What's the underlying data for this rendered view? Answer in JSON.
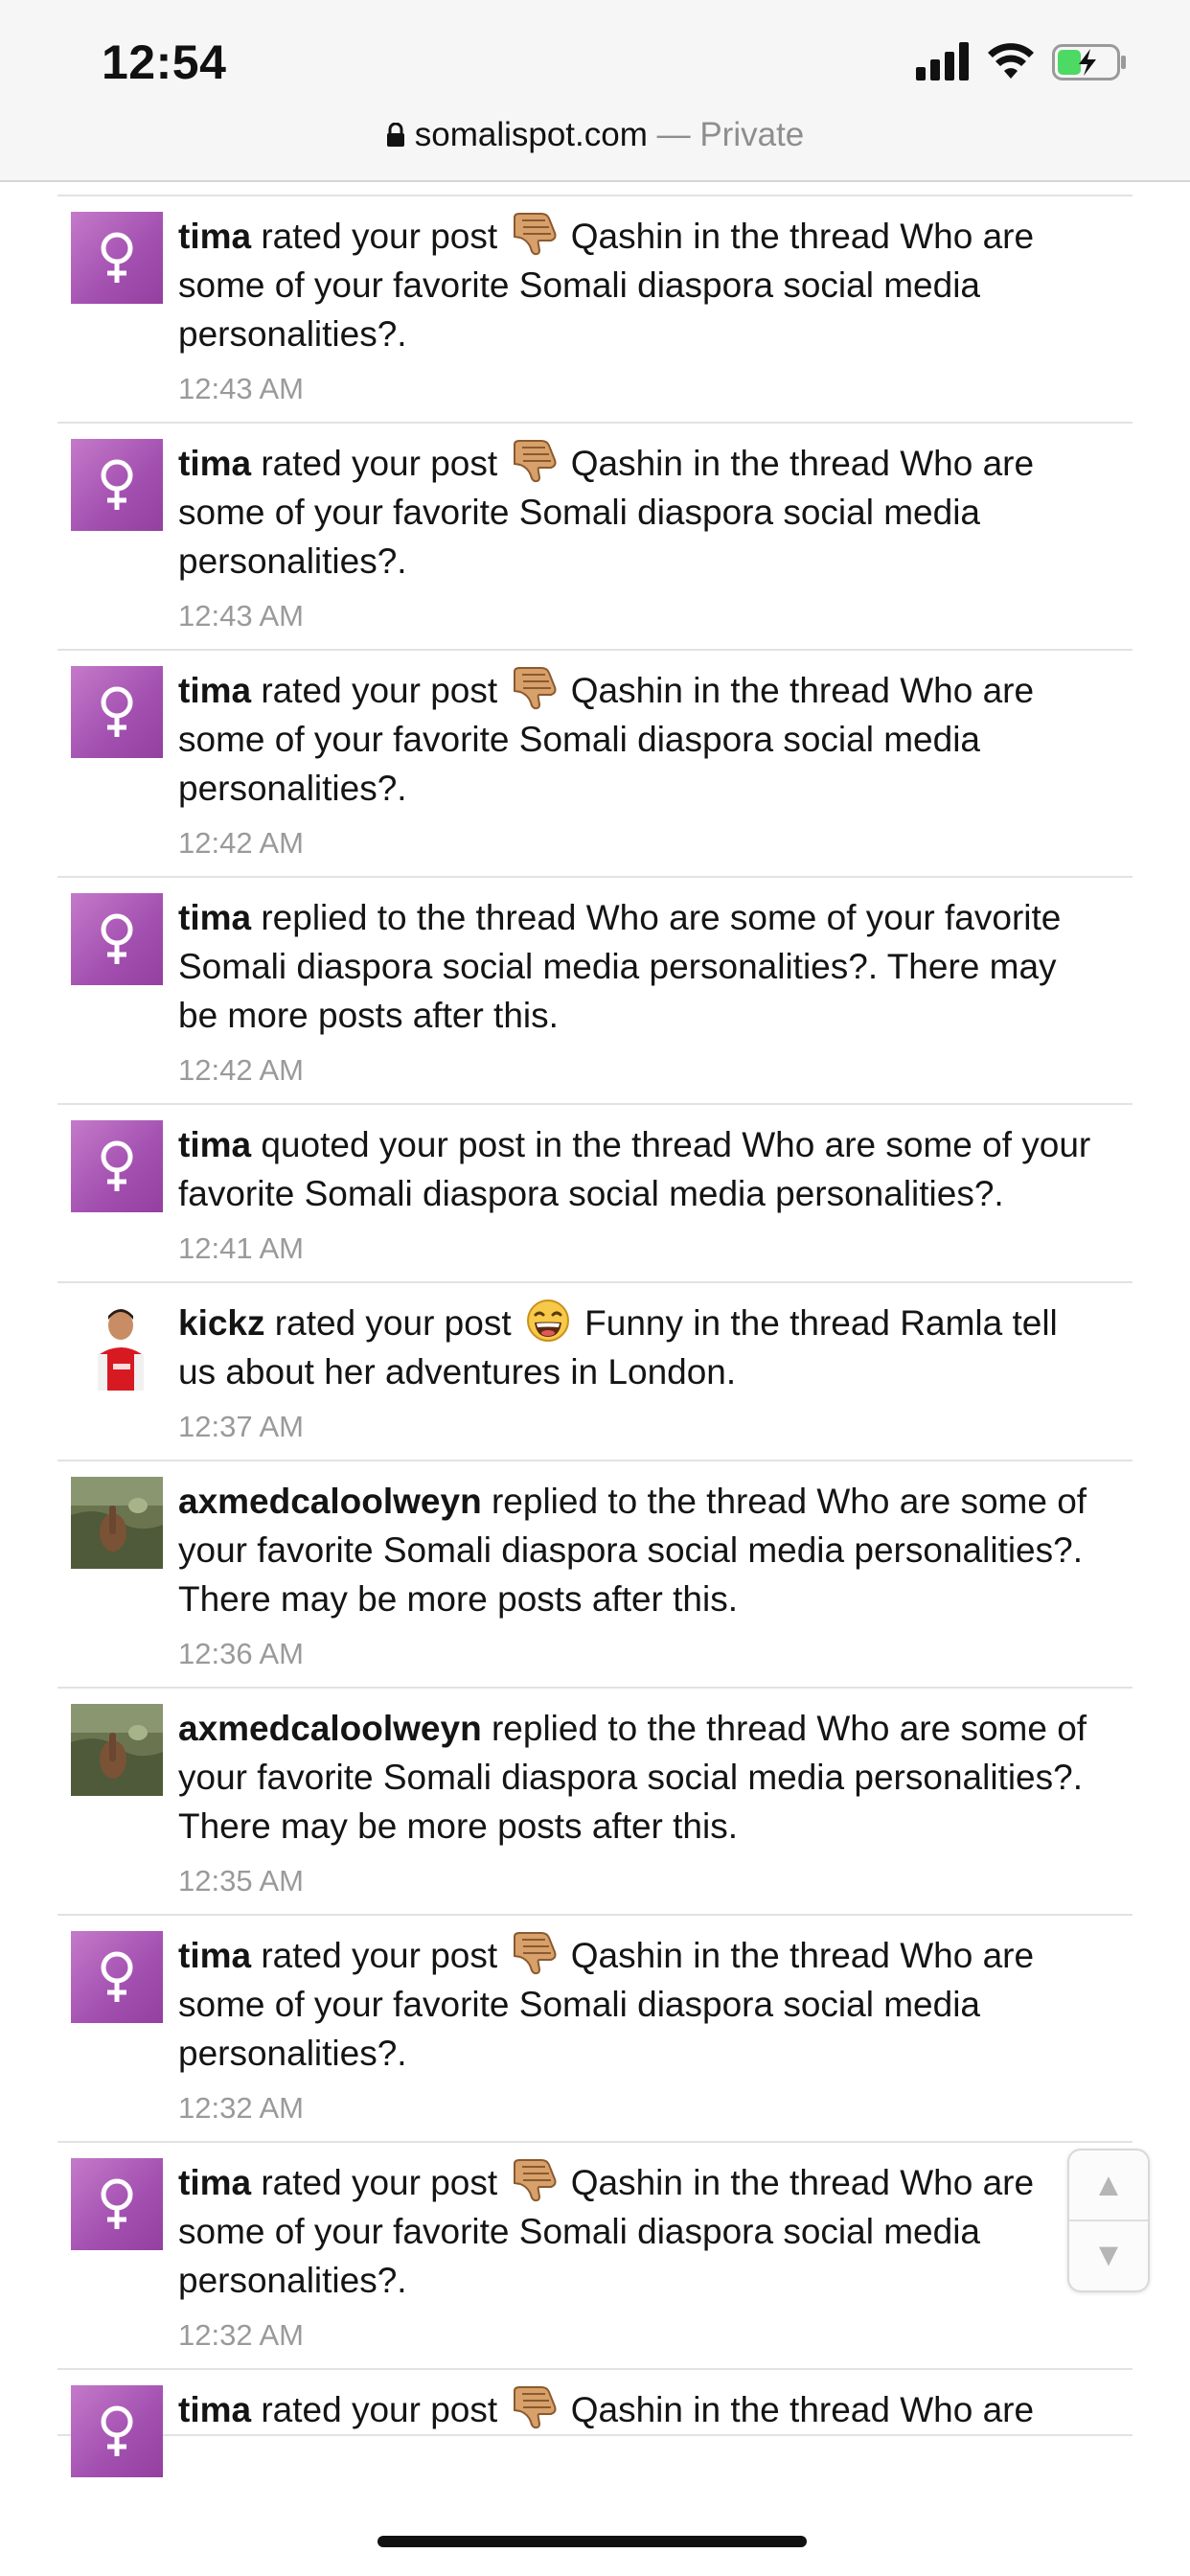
{
  "status_bar": {
    "time": "12:54"
  },
  "url_bar": {
    "domain": "somalispot.com",
    "separator": " — ",
    "mode": "Private"
  },
  "icons": {
    "rating_qashin": "thumbs-down-hand-icon",
    "rating_funny": "laughing-face-icon",
    "avatar_default": "female-symbol-icon",
    "lock": "lock-icon",
    "scroll_up": "triangle-up-icon",
    "scroll_down": "triangle-down-icon"
  },
  "colors": {
    "avatar_purple": "#a24fb0",
    "timestamp_gray": "#9a9a9a",
    "divider": "#e2e2e2"
  },
  "alerts": [
    {
      "user": "tima",
      "avatar": "female",
      "pre": " rated your post ",
      "rating": "thumbs-down-hand-icon",
      "post": " Qashin in the thread Who are some of your favorite Somali diaspora social media personalities?.",
      "time": "12:43 AM"
    },
    {
      "user": "tima",
      "avatar": "female",
      "pre": " rated your post ",
      "rating": "thumbs-down-hand-icon",
      "post": " Qashin in the thread Who are some of your favorite Somali diaspora social media personalities?.",
      "time": "12:43 AM"
    },
    {
      "user": "tima",
      "avatar": "female",
      "pre": " rated your post ",
      "rating": "thumbs-down-hand-icon",
      "post": " Qashin in the thread Who are some of your favorite Somali diaspora social media personalities?.",
      "time": "12:42 AM"
    },
    {
      "user": "tima",
      "avatar": "female",
      "pre": " replied to the thread Who are some of your favorite Somali diaspora social media personalities?. There may be more posts after this.",
      "rating": null,
      "post": "",
      "time": "12:42 AM"
    },
    {
      "user": "tima",
      "avatar": "female",
      "pre": " quoted your post in the thread Who are some of your favorite Somali diaspora social media personalities?.",
      "rating": null,
      "post": "",
      "time": "12:41 AM"
    },
    {
      "user": "kickz",
      "avatar": "kickz",
      "pre": " rated your post ",
      "rating": "laughing-face-icon",
      "post": " Funny in the thread Ramla tell us about her adventures in London.",
      "time": "12:37 AM"
    },
    {
      "user": "axmedcaloolweyn",
      "avatar": "axmed",
      "pre": " replied to the thread Who are some of your favorite Somali diaspora social media personalities?. There may be more posts after this.",
      "rating": null,
      "post": "",
      "time": "12:36 AM"
    },
    {
      "user": "axmedcaloolweyn",
      "avatar": "axmed",
      "pre": " replied to the thread Who are some of your favorite Somali diaspora social media personalities?. There may be more posts after this.",
      "rating": null,
      "post": "",
      "time": "12:35 AM"
    },
    {
      "user": "tima",
      "avatar": "female",
      "pre": " rated your post ",
      "rating": "thumbs-down-hand-icon",
      "post": " Qashin in the thread Who are some of your favorite Somali diaspora social media personalities?.",
      "time": "12:32 AM"
    },
    {
      "user": "tima",
      "avatar": "female",
      "pre": " rated your post ",
      "rating": "thumbs-down-hand-icon",
      "post": " Qashin in the thread Who are some of your favorite Somali diaspora social media personalities?.",
      "time": "12:32 AM"
    },
    {
      "user": "tima",
      "avatar": "female",
      "pre": " rated your post ",
      "rating": "thumbs-down-hand-icon",
      "post": " Qashin in the thread Who are",
      "time": ""
    }
  ],
  "scroll_helper": {
    "up_glyph": "▲",
    "down_glyph": "▼"
  }
}
